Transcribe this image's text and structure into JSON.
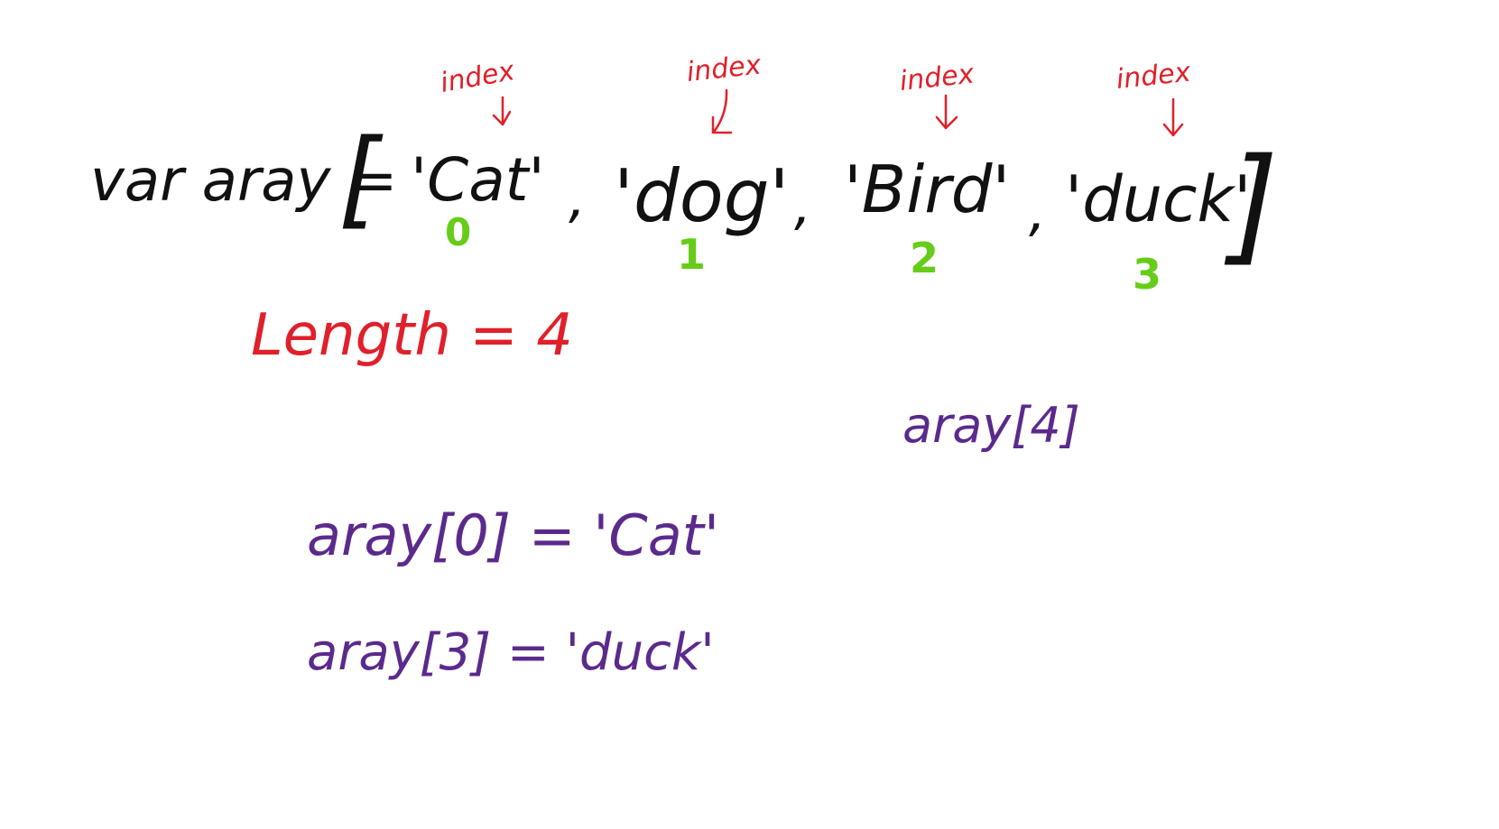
{
  "declaration": {
    "prefix": "var aray =",
    "open_bracket": "[",
    "close_bracket": "]",
    "separator": ",",
    "items": [
      "'Cat'",
      "'dog'",
      "'Bird'",
      "'duck'"
    ]
  },
  "index_label": "index",
  "indices": [
    "0",
    "1",
    "2",
    "3"
  ],
  "length_text": "Length = 4",
  "out_of_range": "aray[4]",
  "examples": [
    "aray[0] = 'Cat'",
    "aray[3] = 'duck'"
  ],
  "colors": {
    "ink": "#111111",
    "annotation": "#e0202a",
    "index_number": "#66cc1a",
    "access": "#5b2a8c"
  }
}
